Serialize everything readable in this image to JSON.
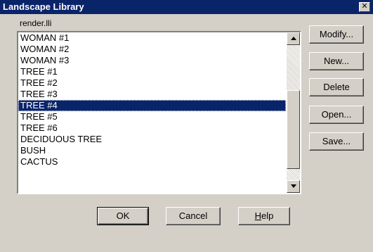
{
  "window": {
    "title": "Landscape Library",
    "close_glyph": "✕"
  },
  "library": {
    "filename": "render.lli",
    "items": [
      "WOMAN #1",
      "WOMAN #2",
      "WOMAN #3",
      "TREE #1",
      "TREE #2",
      "TREE #3",
      "TREE #4",
      "TREE #5",
      "TREE #6",
      "DECIDUOUS TREE",
      "BUSH",
      "CACTUS"
    ],
    "selected": "TREE #4"
  },
  "actions": {
    "modify": "Modify...",
    "new": "New...",
    "delete": "Delete",
    "open": "Open...",
    "save": "Save..."
  },
  "footer": {
    "ok": "OK",
    "cancel": "Cancel",
    "help_first": "H",
    "help_rest": "elp"
  },
  "colors": {
    "titlebar": "#0a246a",
    "selection": "#0a246a",
    "face": "#d4d0c8"
  }
}
